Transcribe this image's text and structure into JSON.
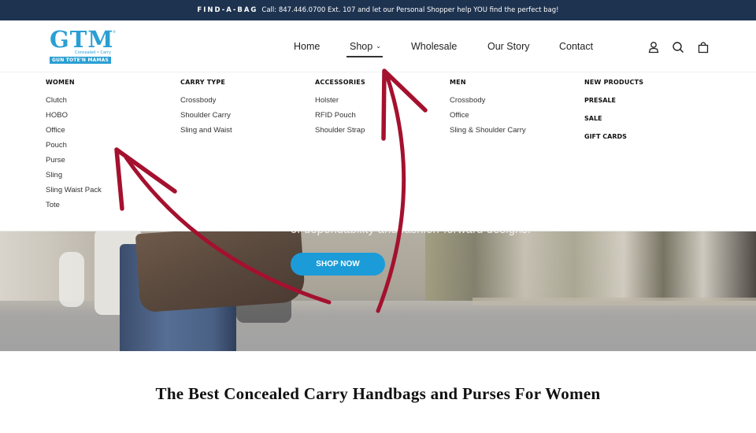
{
  "announcement": {
    "kicker": "FIND-A-BAG",
    "text": "Call: 847.446.0700 Ext. 107 and let our Personal Shopper help YOU find the perfect bag!"
  },
  "logo": {
    "mark": "GTM",
    "trademark": "®",
    "tagline": "Concealed • Carry",
    "band": "GUN TOTE'N MAMAS"
  },
  "nav": {
    "items": [
      {
        "label": "Home"
      },
      {
        "label": "Shop",
        "caret": "⌄",
        "active": true
      },
      {
        "label": "Wholesale"
      },
      {
        "label": "Our Story"
      },
      {
        "label": "Contact"
      }
    ]
  },
  "header_icons": [
    "account-icon",
    "search-icon",
    "cart-icon"
  ],
  "mega_menu": {
    "columns": [
      {
        "heading": "WOMEN",
        "links": [
          "Clutch",
          "HOBO",
          "Office",
          "Pouch",
          "Purse",
          "Sling",
          "Sling Waist Pack",
          "Tote"
        ]
      },
      {
        "heading": "CARRY TYPE",
        "links": [
          "Crossbody",
          "Shoulder Carry",
          "Sling and Waist"
        ]
      },
      {
        "heading": "ACCESSORIES",
        "links": [
          "Holster",
          "RFID Pouch",
          "Shoulder Strap"
        ]
      },
      {
        "heading": "MEN",
        "links": [
          "Crossbody",
          "Office",
          "Sling & Shoulder Carry"
        ]
      },
      {
        "heading": "NEW PRODUCTS",
        "bold_links": [
          "PRESALE",
          "SALE",
          "GIFT CARDS"
        ]
      }
    ]
  },
  "hero": {
    "tagline": "of dependability and fashion-forward designs.",
    "button": "SHOP NOW"
  },
  "section": {
    "title": "The Best Concealed Carry Handbags and Purses For Women"
  },
  "colors": {
    "announcement_bg": "#1e3350",
    "brand_blue": "#2b9fd3",
    "button_blue": "#1b9cd8",
    "annotation_red": "#a4112e"
  }
}
